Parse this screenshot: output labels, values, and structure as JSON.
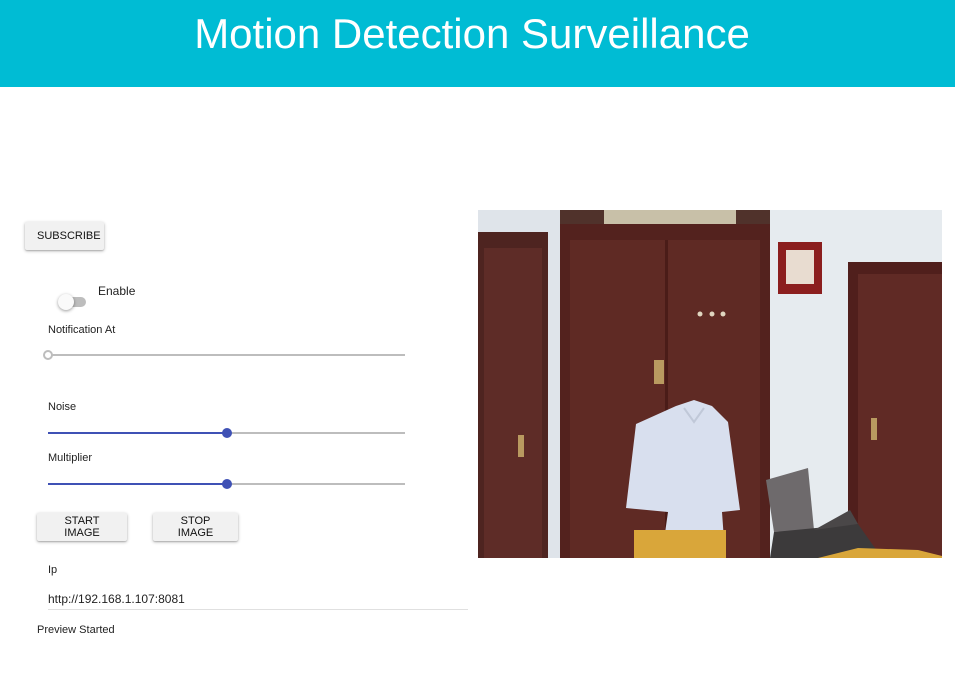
{
  "header": {
    "title": "Motion Detection Surveillance",
    "color": "#00bcd4"
  },
  "controls": {
    "subscribe_label": "SUBSCRIBE",
    "enable": {
      "label": "Enable",
      "checked": false
    },
    "sliders": [
      {
        "label": "Notification At",
        "value": 0
      },
      {
        "label": "Noise",
        "value": 0.5
      },
      {
        "label": "Multiplier",
        "value": 0.5
      }
    ],
    "start_label": "START IMAGE",
    "stop_label": "STOP IMAGE",
    "ip": {
      "label": "Ip",
      "value": "http://192.168.1.107:8081"
    },
    "status": "Preview Started",
    "accent_color": "#3f51b5"
  },
  "preview": {
    "icon": "camera-preview-image"
  }
}
